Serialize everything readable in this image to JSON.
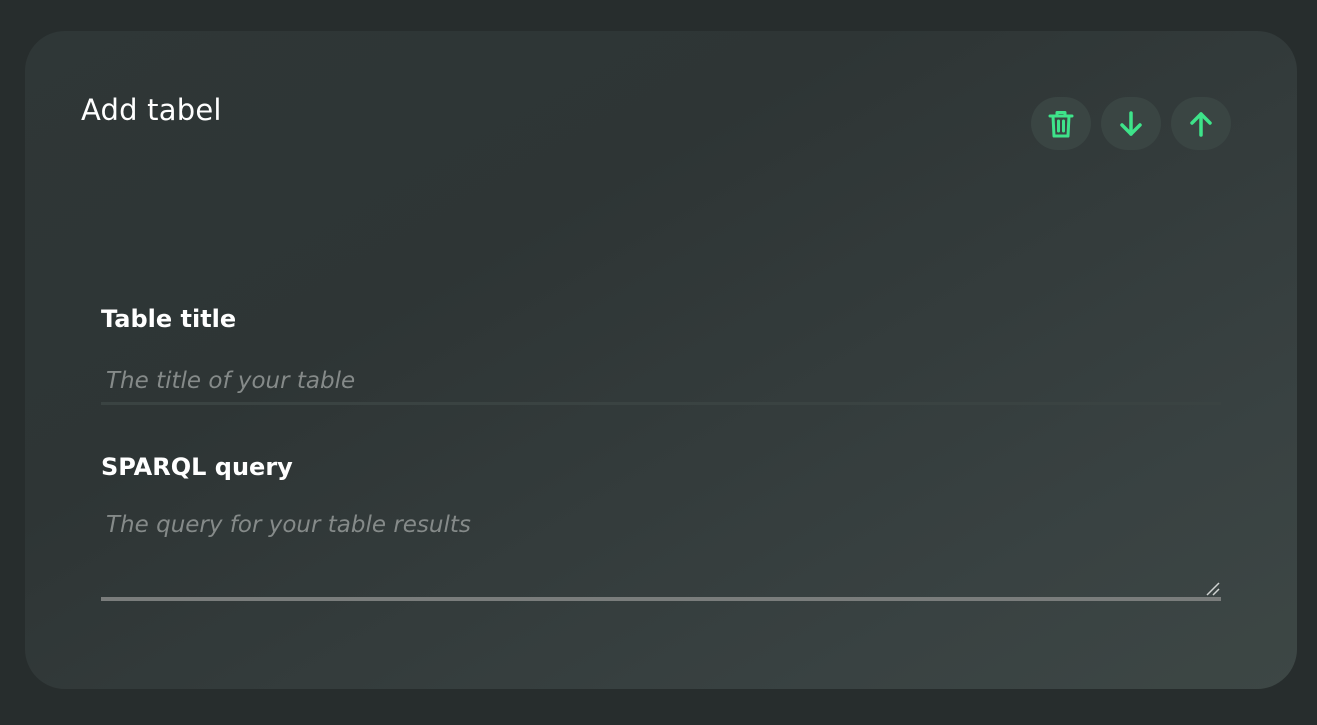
{
  "card": {
    "title": "Add tabel",
    "actions": [
      {
        "icon": "trash-icon",
        "color": "#3ee38a"
      },
      {
        "icon": "arrow-down-icon",
        "color": "#3ee38a"
      },
      {
        "icon": "arrow-up-icon",
        "color": "#3ee38a"
      }
    ]
  },
  "form": {
    "title_field": {
      "label": "Table title",
      "placeholder": "The title of your table",
      "value": ""
    },
    "query_field": {
      "label": "SPARQL query",
      "placeholder": "The query for your table results",
      "value": ""
    }
  },
  "colors": {
    "page_background": "#272d2d",
    "card_background": "#323a3a",
    "accent": "#3ee38a",
    "placeholder": "#858a89"
  }
}
